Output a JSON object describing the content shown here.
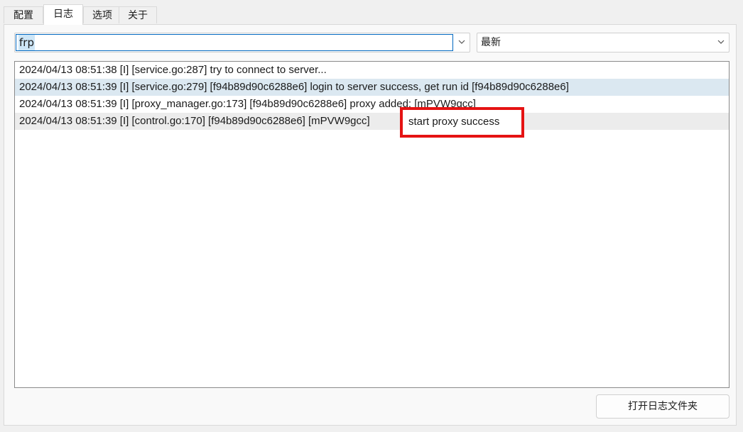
{
  "tabs": [
    {
      "label": "配置"
    },
    {
      "label": "日志"
    },
    {
      "label": "选项"
    },
    {
      "label": "关于"
    }
  ],
  "active_tab": "日志",
  "proxy_select": {
    "value": "frp",
    "icon": "chevron-down-icon"
  },
  "sort_select": {
    "value": "最新",
    "icon": "chevron-down-icon"
  },
  "log_lines": [
    "2024/04/13 08:51:38 [I] [service.go:287] try to connect to server...",
    "2024/04/13 08:51:39 [I] [service.go:279] [f94b89d90c6288e6] login to server success, get run id [f94b89d90c6288e6]",
    "2024/04/13 08:51:39 [I] [proxy_manager.go:173] [f94b89d90c6288e6] proxy added: [mPVW9gcc]",
    "2024/04/13 08:51:39 [I] [control.go:170] [f94b89d90c6288e6] [mPVW9gcc]"
  ],
  "highlight": {
    "text": "start proxy success",
    "color": "#e51313"
  },
  "open_folder_button": "打开日志文件夹",
  "colors": {
    "selection": "#dbe8f1",
    "focus_border": "#0067c0",
    "annotation": "#e51313"
  }
}
